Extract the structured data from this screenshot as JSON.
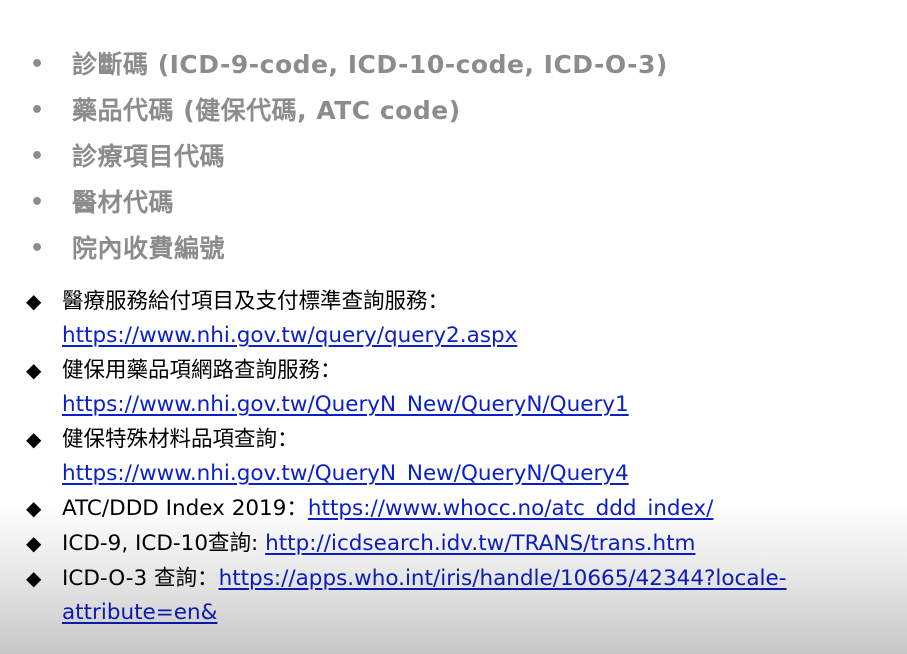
{
  "gray_bullets": [
    {
      "bullet": "•",
      "text": "診斷碼 (ICD-9-code, ICD-10-code, ICD-O-3)"
    },
    {
      "bullet": "•",
      "text": "藥品代碼 (健保代碼, ATC code)"
    },
    {
      "bullet": "•",
      "text": "診療項目代碼"
    },
    {
      "bullet": "•",
      "text": "醫材代碼"
    },
    {
      "bullet": "•",
      "text": "院內收費編號"
    }
  ],
  "resources": [
    {
      "marker": "◆",
      "label": "醫療服務給付項目及支付標準查詢服務：",
      "url": "https://www.nhi.gov.tw/query/query2.aspx"
    },
    {
      "marker": "◆",
      "label": "健保用藥品項網路查詢服務：",
      "url": "https://www.nhi.gov.tw/QueryN_New/QueryN/Query1"
    },
    {
      "marker": "◆",
      "label": "健保特殊材料品項查詢：",
      "url": "https://www.nhi.gov.tw/QueryN_New/QueryN/Query4"
    },
    {
      "marker": "◆",
      "label": "ATC/DDD Index 2019：",
      "url": "https://www.whocc.no/atc_ddd_index/"
    },
    {
      "marker": "◆",
      "label": "ICD-9, ICD-10查詢: ",
      "url": "http://icdsearch.idv.tw/TRANS/trans.htm"
    },
    {
      "marker": "◆",
      "label": "ICD-O-3 查詢：",
      "url_line1": "https://apps.who.int/iris/handle/10665/42344?locale-",
      "url_line2": "attribute=en&"
    }
  ],
  "colors": {
    "gray_text": "#8c8c8c",
    "link": "#0b20c8",
    "body_text": "#000000"
  }
}
